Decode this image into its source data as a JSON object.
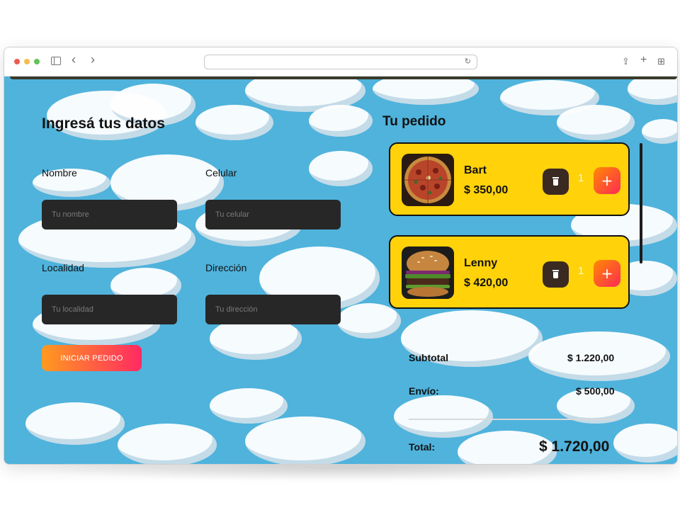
{
  "browser": {
    "back_icon": "‹",
    "forward_icon": "›",
    "reload_icon": "↻",
    "share_icon": "⇪",
    "new_tab_icon": "+",
    "tabs_icon": "⊞"
  },
  "form": {
    "title": "Ingresá tus datos",
    "fields": {
      "nombre": {
        "label": "Nombre",
        "placeholder": "Tu nombre"
      },
      "celular": {
        "label": "Celular",
        "placeholder": "Tu celular"
      },
      "localidad": {
        "label": "Localidad",
        "placeholder": "Tu localidad"
      },
      "direccion": {
        "label": "Dirección",
        "placeholder": "Tu dirección"
      }
    },
    "submit_label": "INICIAR PEDIDO"
  },
  "order": {
    "title": "Tu pedido",
    "items": [
      {
        "name": "Bart",
        "price": "$ 350,00",
        "qty": "1",
        "plus": "+"
      },
      {
        "name": "Lenny",
        "price": "$ 420,00",
        "qty": "1",
        "plus": "+"
      }
    ],
    "subtotal_label": "Subtotal",
    "subtotal_value": "$ 1.220,00",
    "shipping_label": "Envío:",
    "shipping_value": "$ 500,00",
    "total_label": "Total:",
    "total_value": "$ 1.720,00"
  },
  "colors": {
    "background_sky": "#4fb3dc",
    "card_yellow": "#ffd20a",
    "input_dark": "#272727",
    "accent_gradient_start": "#ff9a1f",
    "accent_gradient_end": "#ff2a62"
  }
}
